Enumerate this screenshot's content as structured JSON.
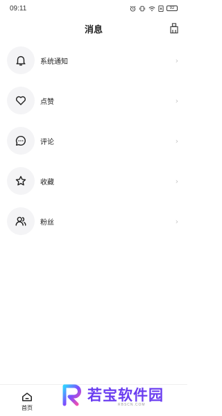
{
  "status_bar": {
    "time": "09:11",
    "battery": "92"
  },
  "header": {
    "title": "消息"
  },
  "rows": [
    {
      "label": "系统通知",
      "icon": "bell-icon"
    },
    {
      "label": "点赞",
      "icon": "heart-icon"
    },
    {
      "label": "评论",
      "icon": "comment-icon"
    },
    {
      "label": "收藏",
      "icon": "star-icon"
    },
    {
      "label": "粉丝",
      "icon": "users-icon"
    }
  ],
  "tab_bar": {
    "home_label": "首页"
  },
  "watermark": {
    "text": "若宝软件园",
    "sub": "RBSCN.COM"
  },
  "colors": {
    "watermark": "#6a3df0",
    "icon_bg": "#f4f4f6",
    "arrow": "#c8c8c8"
  }
}
